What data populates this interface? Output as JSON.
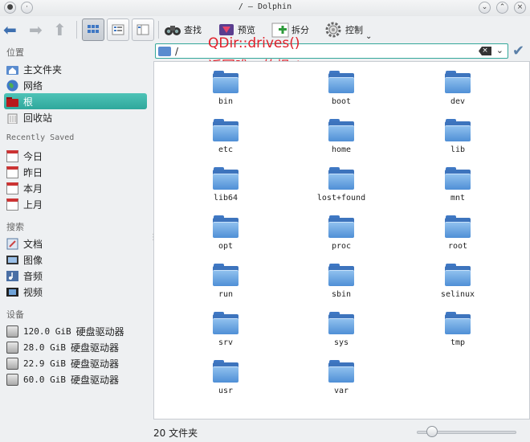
{
  "window": {
    "title": "/ — Dolphin"
  },
  "toolbar": {
    "find_label": "查找",
    "preview_label": "预览",
    "split_label": "拆分",
    "control_label": "控制"
  },
  "sidebar": {
    "sections": {
      "places": "位置",
      "recently_saved": "Recently Saved",
      "search": "搜索",
      "devices": "设备"
    },
    "places": [
      {
        "label": "主文件夹",
        "icon": "home-folder-icon"
      },
      {
        "label": "网络",
        "icon": "network-globe-icon"
      },
      {
        "label": "根",
        "icon": "root-folder-icon",
        "active": true
      },
      {
        "label": "回收站",
        "icon": "trash-icon"
      }
    ],
    "recent": [
      {
        "label": "今日",
        "icon": "calendar-today-icon"
      },
      {
        "label": "昨日",
        "icon": "calendar-yesterday-icon"
      },
      {
        "label": "本月",
        "icon": "calendar-month-icon"
      },
      {
        "label": "上月",
        "icon": "calendar-last-month-icon"
      }
    ],
    "search": [
      {
        "label": "文档",
        "icon": "documents-icon"
      },
      {
        "label": "图像",
        "icon": "images-icon"
      },
      {
        "label": "音频",
        "icon": "audio-icon"
      },
      {
        "label": "视频",
        "icon": "video-icon"
      }
    ],
    "devices": [
      {
        "size": "120.0 GiB",
        "label": "硬盘驱动器"
      },
      {
        "size": "28.0 GiB",
        "label": "硬盘驱动器"
      },
      {
        "size": "22.9 GiB",
        "label": "硬盘驱动器"
      },
      {
        "size": "60.0 GiB",
        "label": "硬盘驱动器"
      }
    ]
  },
  "location": {
    "path": "/"
  },
  "annotation": {
    "line1": "QDir::drives()",
    "line2": "返回唯一的根 /"
  },
  "files": [
    "bin",
    "boot",
    "dev",
    "etc",
    "home",
    "lib",
    "lib64",
    "lost+found",
    "mnt",
    "opt",
    "proc",
    "root",
    "run",
    "sbin",
    "selinux",
    "srv",
    "sys",
    "tmp",
    "usr",
    "var"
  ],
  "status": {
    "item_count": "20 文件夹"
  },
  "zoom": {
    "level": 0.15
  },
  "colors": {
    "accent": "#34a79a",
    "folder": "#4f8fd6",
    "annotation": "#e0202a"
  }
}
